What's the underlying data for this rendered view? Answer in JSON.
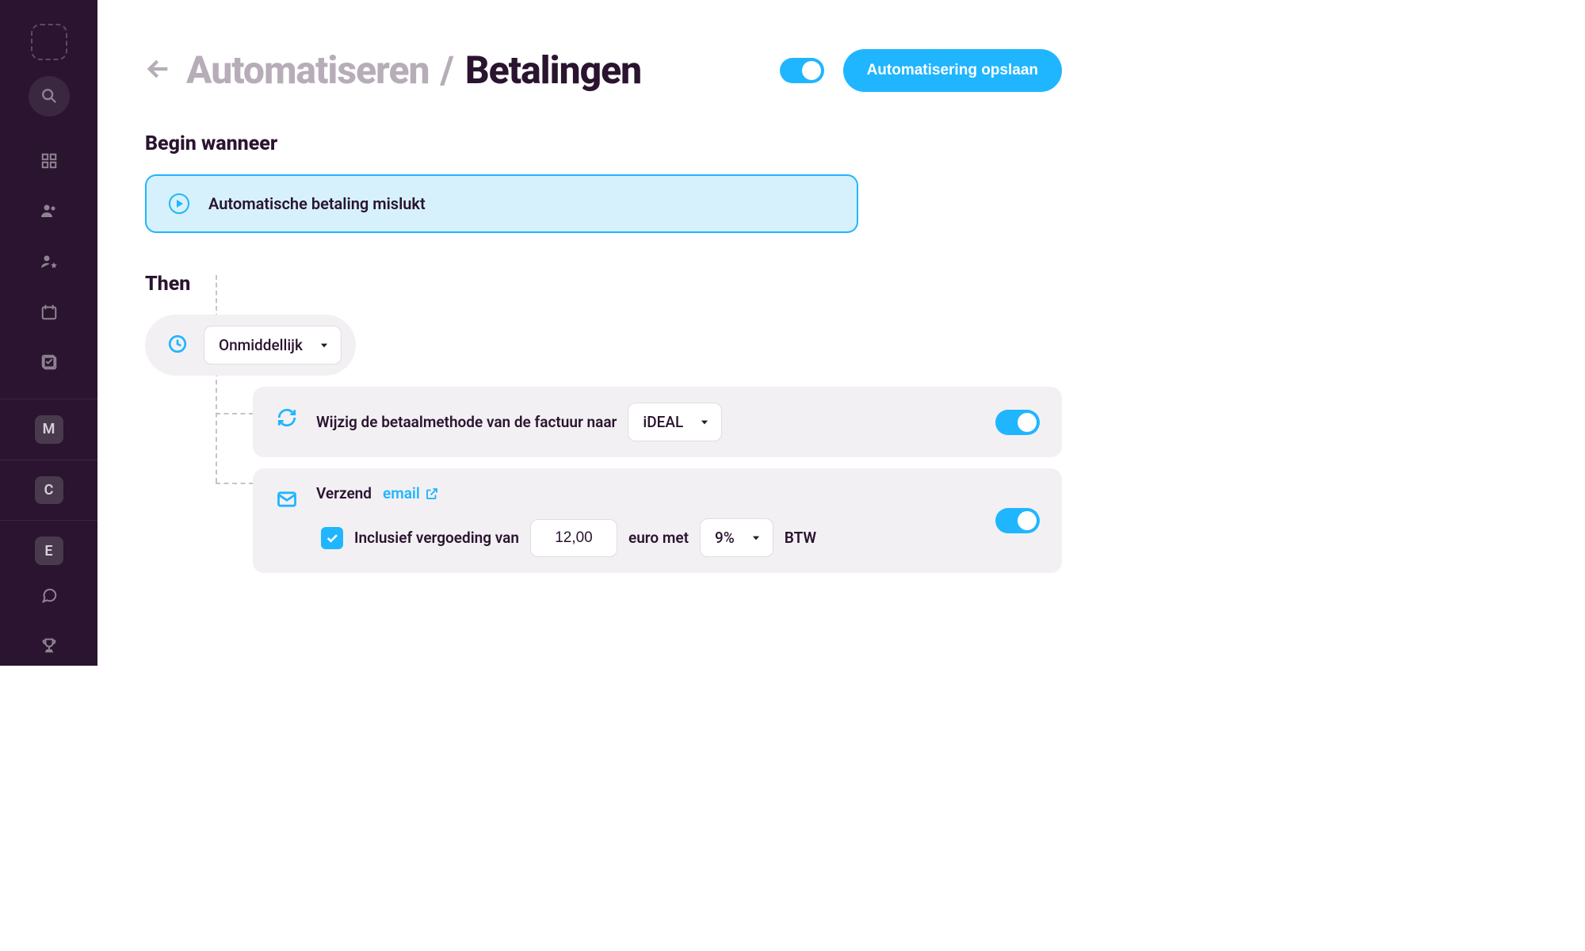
{
  "sidebar": {
    "badges": [
      "M",
      "C",
      "E"
    ]
  },
  "header": {
    "breadcrumb_parent": "Automatiseren",
    "breadcrumb_current": "Betalingen",
    "save_label": "Automatisering opslaan"
  },
  "sections": {
    "begin_label": "Begin wanneer",
    "then_label": "Then"
  },
  "trigger": {
    "label": "Automatische betaling mislukt"
  },
  "group": {
    "timing_label": "Onmiddellijk"
  },
  "action1": {
    "prefix": "Wijzig de betaalmethode van de factuur naar",
    "method": "iDEAL"
  },
  "action2": {
    "prefix": "Verzend",
    "link": "email",
    "fee_prefix": "Inclusief vergoeding van",
    "fee_amount": "12,00",
    "fee_mid": "euro met",
    "fee_vat": "9%",
    "fee_suffix": "BTW"
  }
}
